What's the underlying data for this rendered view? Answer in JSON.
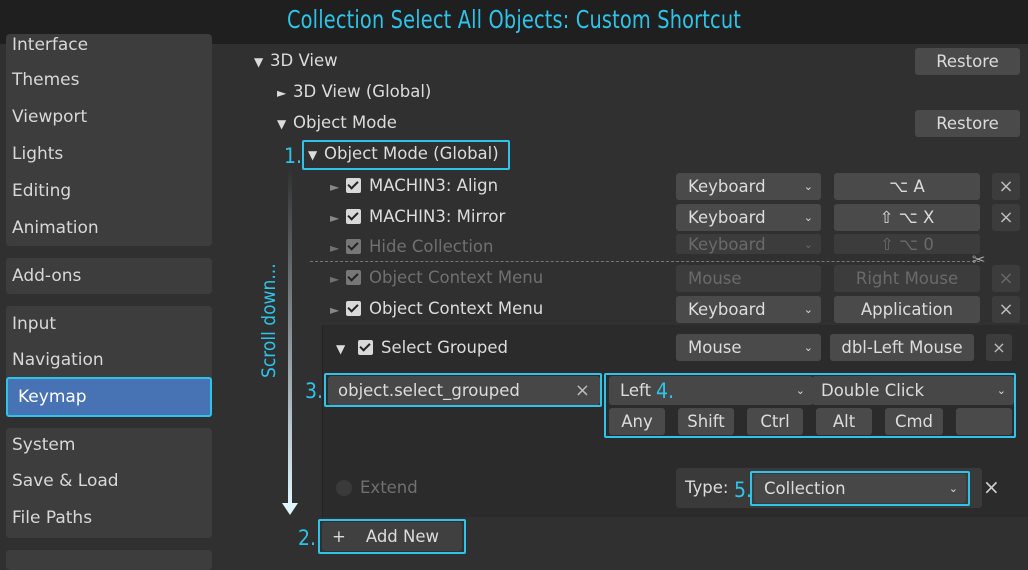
{
  "title": "Collection Select All Objects: Custom Shortcut",
  "sidebar": {
    "items": [
      "Interface",
      "Themes",
      "Viewport",
      "Lights",
      "Editing",
      "Animation",
      "Add-ons",
      "Input",
      "Navigation",
      "Keymap",
      "System",
      "Save & Load",
      "File Paths"
    ]
  },
  "tree": {
    "view3d": "3D View",
    "restore": "Restore",
    "view3d_global": "3D View (Global)",
    "object_mode": "Object Mode",
    "object_mode_global": "Object Mode (Global)"
  },
  "items": [
    {
      "name": "MACHIN3: Align",
      "type": "Keyboard",
      "key": "⌥ A"
    },
    {
      "name": "MACHIN3: Mirror",
      "type": "Keyboard",
      "key": "⇧ ⌥ X"
    },
    {
      "name": "Hide Collection",
      "type": "Keyboard",
      "key": "⇧ ⌥ 0"
    },
    {
      "name": "Object Context Menu",
      "type": "Mouse",
      "key": "Right Mouse"
    },
    {
      "name": "Object Context Menu",
      "type": "Keyboard",
      "key": "Application"
    }
  ],
  "expanded": {
    "name": "Select Grouped",
    "type": "Mouse",
    "key": "dbl-Left Mouse",
    "operator": "object.select_grouped",
    "button": "Left",
    "event": "Double Click",
    "modifiers": [
      "Any",
      "Shift",
      "Ctrl",
      "Alt",
      "Cmd"
    ],
    "extend": "Extend",
    "type_label": "Type:",
    "type_value": "Collection"
  },
  "add_new": "Add New",
  "annotations": {
    "n1": "1.",
    "n2": "2.",
    "n3": "3.",
    "n4": "4.",
    "n5": "5.",
    "scroll": "Scroll down..."
  },
  "colors": {
    "accent": "#2ec4ea",
    "active": "#4772b3"
  },
  "icons": {
    "close": "close-icon",
    "chevron": "chevron-down-icon",
    "triangle": "disclosure-triangle-icon",
    "scissors": "scissors-icon"
  }
}
